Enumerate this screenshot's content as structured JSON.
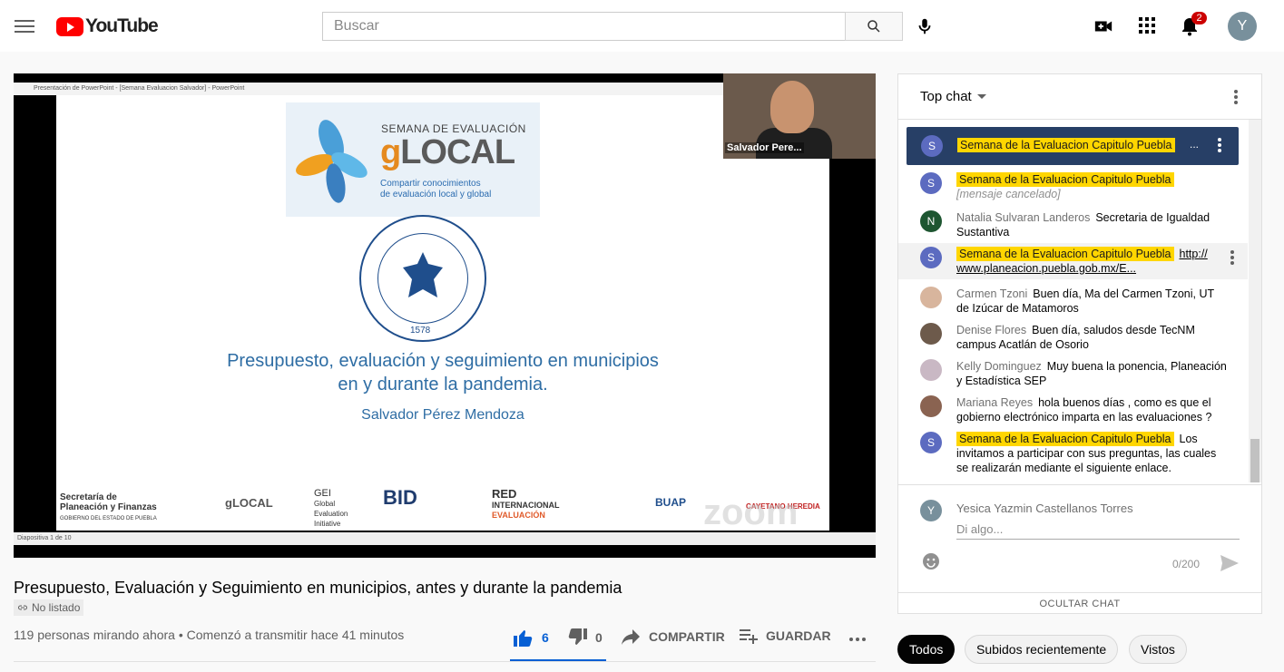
{
  "header": {
    "logo_text": "YouTube",
    "search_placeholder": "Buscar",
    "notification_count": "2",
    "avatar_letter": "Y"
  },
  "video": {
    "ppt_window_title": "Presentación de PowerPoint - [Semana Evaluacion Salvador] - PowerPoint",
    "slide": {
      "brand_small": "SEMANA DE EVALUACIÓN",
      "brand_big_g": "g",
      "brand_big_rest": "LOCAL",
      "brand_tag_line1": "Compartir conocimientos",
      "brand_tag_line2": "de evaluación local y global",
      "seal_year": "1578",
      "title_line1": "Presupuesto, evaluación y seguimiento en municipios",
      "title_line2": "en y durante la pandemia.",
      "author": "Salvador Pérez Mendoza",
      "sponsors": {
        "sec_line1": "Secretaría de",
        "sec_line2": "Planeación y Finanzas",
        "sec_line3": "GOBIERNO DEL ESTADO DE PUEBLA",
        "glocal": "gLOCAL",
        "gei_line1": "GEI",
        "gei_line2": "Global",
        "gei_line3": "Evaluation",
        "gei_line4": "Initiative",
        "bid": "BID",
        "red_line1": "RED",
        "red_line2": "INTERNACIONAL",
        "red_line3": "EVALUACIÓN",
        "buap": "BUAP",
        "cayetano": "CAYETANO HEREDIA"
      },
      "zoom_watermark": "zoom"
    },
    "camera_name": "Salvador Pere...",
    "slide_status": "Diapositiva 1 de 10"
  },
  "info": {
    "title": "Presupuesto, Evaluación y Seguimiento en municipios, antes y durante la pandemia",
    "unlisted": "No listado",
    "views": "119 personas mirando ahora • Comenzó a transmitir hace 41 minutos",
    "likes": "6",
    "dislikes": "0",
    "share": "COMPARTIR",
    "save": "GUARDAR"
  },
  "chat": {
    "mode": "Top chat",
    "pinned_author": "Semana de la Evaluacion Capitulo Puebla",
    "pinned_more": "...",
    "messages": [
      {
        "author": "Semana de la Evaluacion Capitulo Puebla",
        "text": "[mensaje cancelado]",
        "avatar": "S",
        "owner": true,
        "color": "#5c6bc0"
      },
      {
        "author": "Natalia Sulvaran Landeros",
        "text": "Secretaria de Igualdad Sustantiva",
        "avatar": "N",
        "owner": false,
        "color": "#1e5631"
      },
      {
        "author": "Semana de la Evaluacion Capitulo Puebla",
        "text": "http:// www.planeacion.puebla.gob.mx/E...",
        "avatar": "S",
        "owner": true,
        "color": "#5c6bc0"
      },
      {
        "author": "Carmen Tzoni",
        "text": "Buen día, Ma del Carmen Tzoni, UT de Izúcar de Matamoros",
        "avatar": "",
        "owner": false,
        "color": "#d8b59d"
      },
      {
        "author": "Denise Flores",
        "text": "Buen día, saludos desde TecNM campus Acatlán de Osorio",
        "avatar": "",
        "owner": false,
        "color": "#6d5a4b"
      },
      {
        "author": "Kelly Dominguez",
        "text": "Muy buena la ponencia, Planeación y Estadística SEP",
        "avatar": "",
        "owner": false,
        "color": "#c9b8c4"
      },
      {
        "author": "Mariana Reyes",
        "text": "hola buenos días , como es que el gobierno electrónico imparta en las evaluaciones ?",
        "avatar": "",
        "owner": false,
        "color": "#8a6351"
      },
      {
        "author": "Semana de la Evaluacion Capitulo Puebla",
        "text": "Los invitamos a participar con sus preguntas, las cuales se realizarán mediante el siguiente enlace.",
        "avatar": "S",
        "owner": true,
        "color": "#5c6bc0"
      }
    ],
    "me_name": "Yesica Yazmin Castellanos Torres",
    "me_avatar": "Y",
    "input_placeholder": "Di algo...",
    "counter": "0/200",
    "hide_chat": "OCULTAR CHAT"
  },
  "chips": [
    "Todos",
    "Subidos recientemente",
    "Vistos"
  ]
}
